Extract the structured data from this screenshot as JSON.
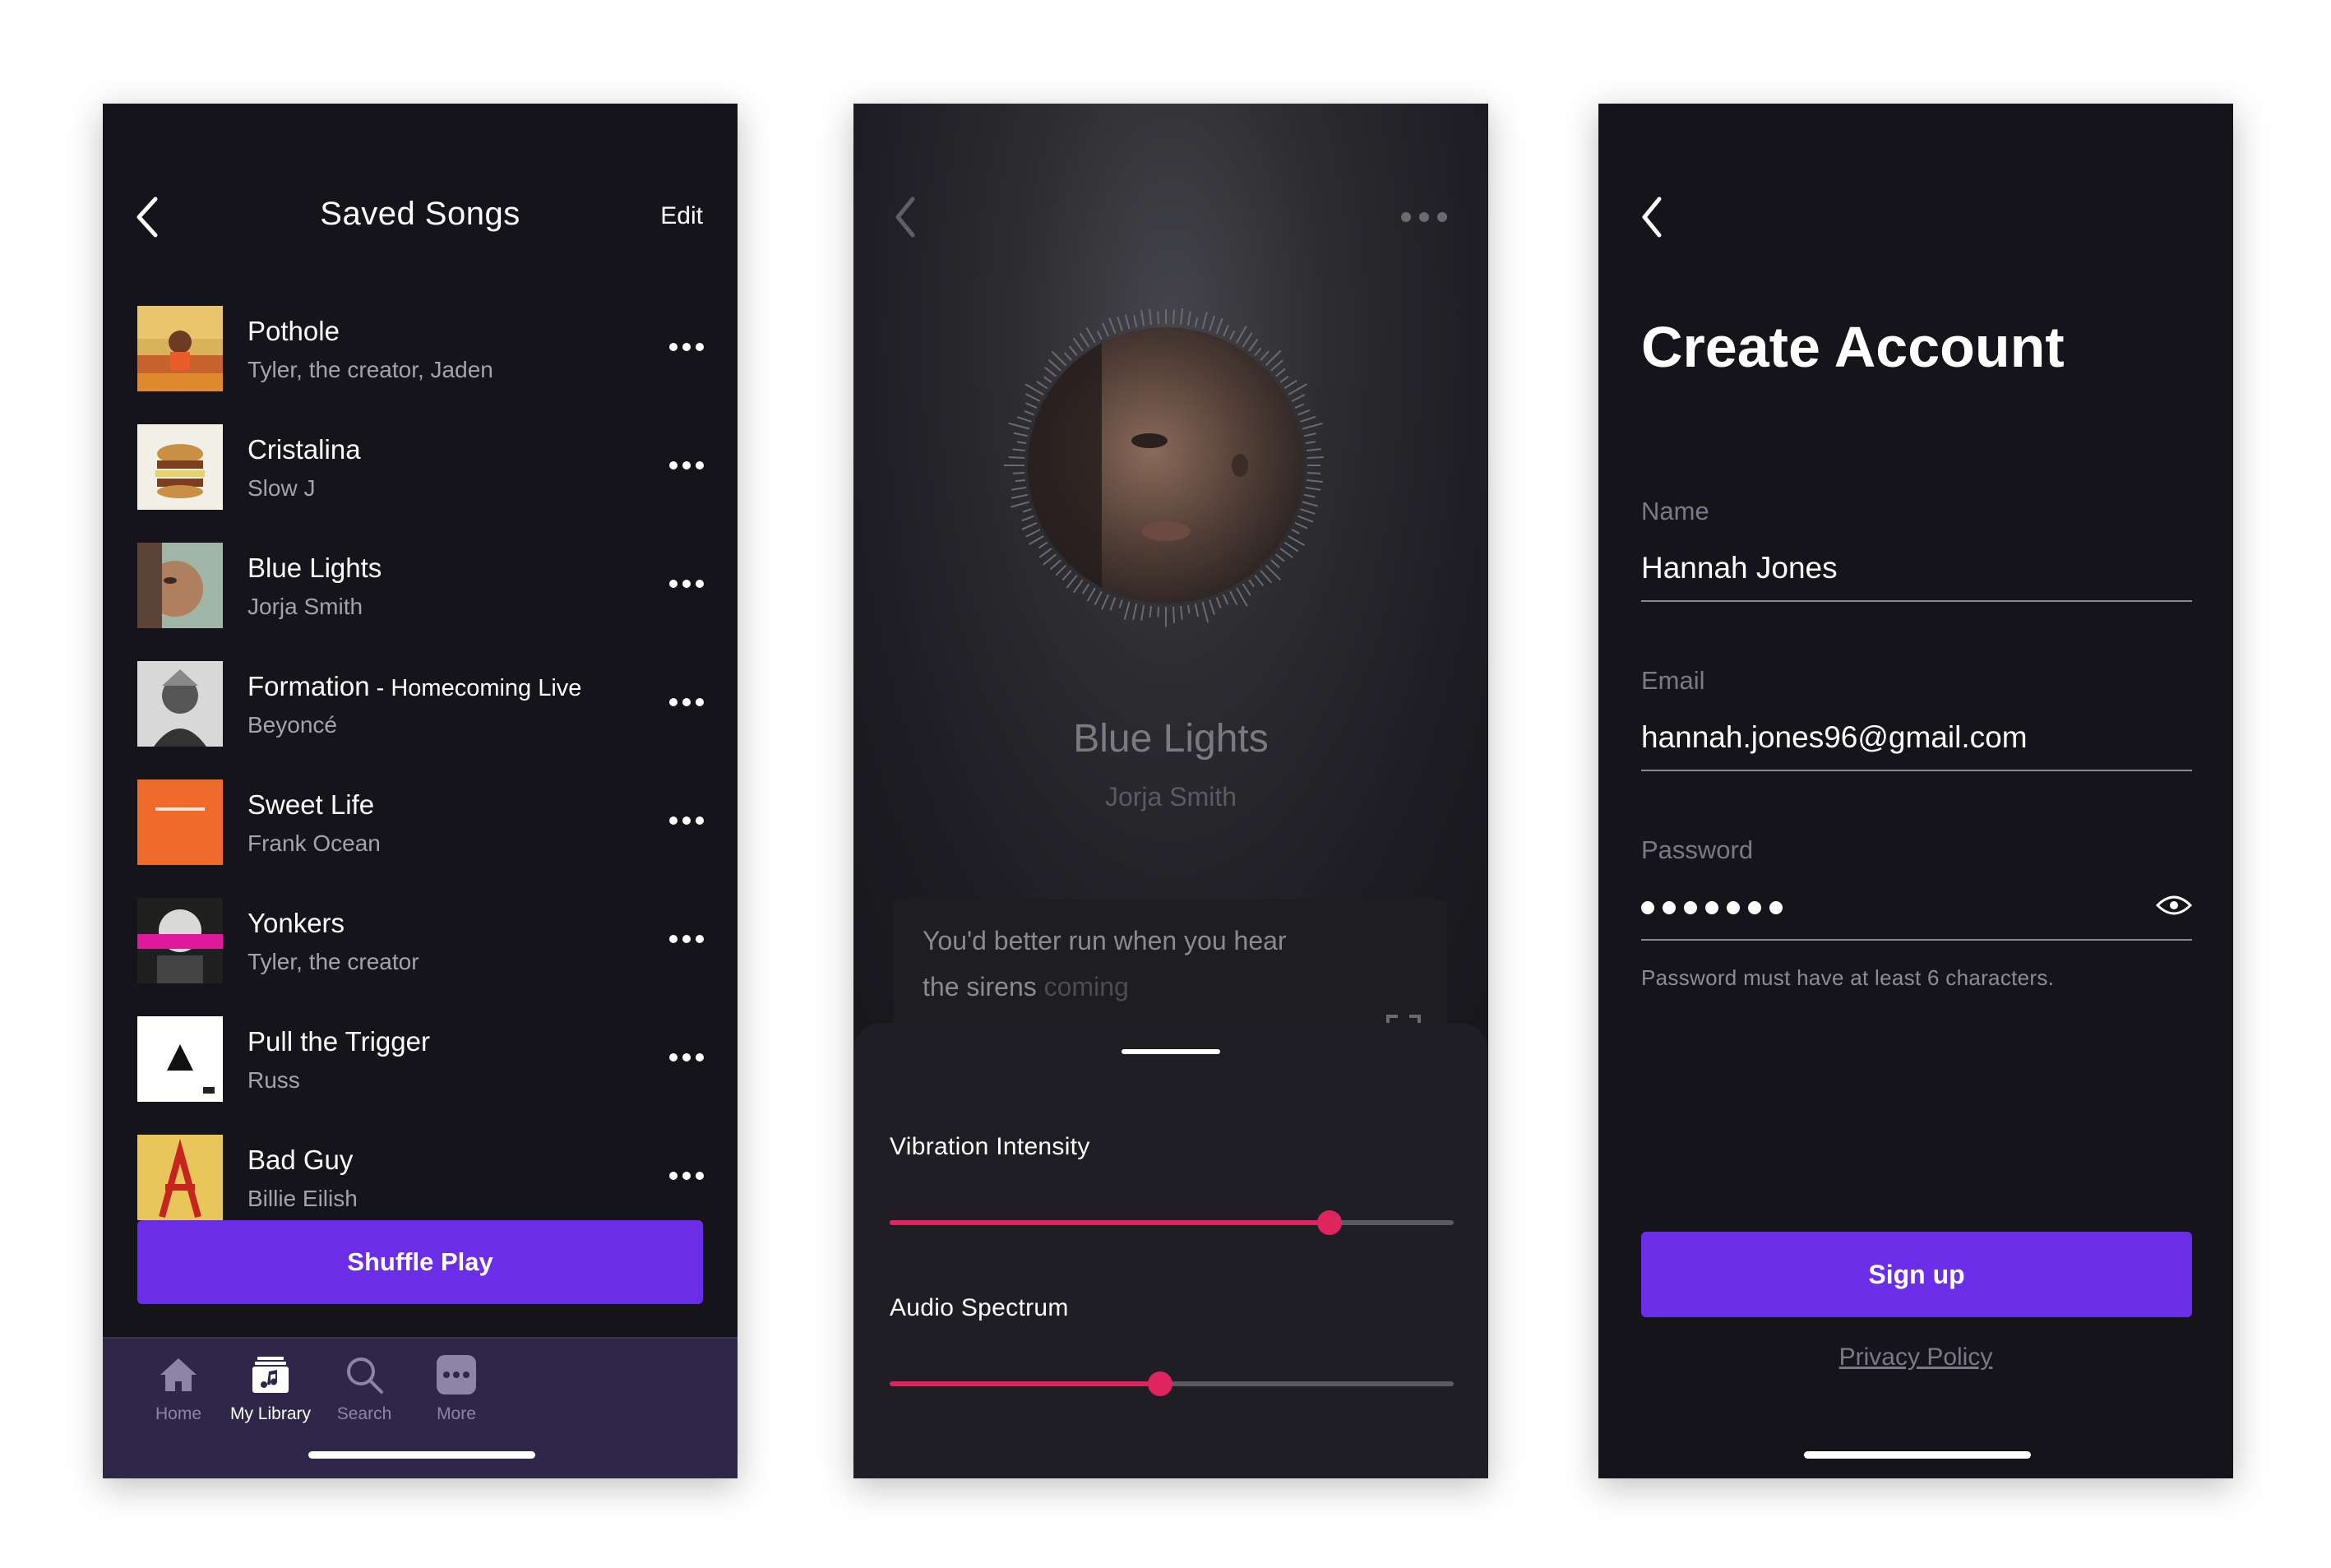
{
  "screen1": {
    "title": "Saved Songs",
    "edit_label": "Edit",
    "songs": [
      {
        "title": "Pothole",
        "subtitle": "",
        "artist": "Tyler, the creator, Jaden"
      },
      {
        "title": "Cristalina",
        "subtitle": "",
        "artist": "Slow J"
      },
      {
        "title": "Blue Lights",
        "subtitle": "",
        "artist": "Jorja Smith"
      },
      {
        "title": "Formation",
        "subtitle": " - Homecoming Live",
        "artist": "Beyoncé"
      },
      {
        "title": "Sweet Life",
        "subtitle": "",
        "artist": "Frank Ocean"
      },
      {
        "title": "Yonkers",
        "subtitle": "",
        "artist": "Tyler, the creator"
      },
      {
        "title": "Pull the Trigger",
        "subtitle": "",
        "artist": "Russ"
      },
      {
        "title": "Bad Guy",
        "subtitle": "",
        "artist": "Billie Eilish"
      }
    ],
    "shuffle_label": "Shuffle Play",
    "tabs": [
      {
        "label": "Home",
        "icon": "home-icon"
      },
      {
        "label": "My Library",
        "icon": "library-icon"
      },
      {
        "label": "Search",
        "icon": "search-icon"
      },
      {
        "label": "More",
        "icon": "more-icon"
      }
    ],
    "active_tab": "My Library",
    "colors": {
      "background": "#16141b",
      "accent": "#6a2de8",
      "tabbar": "#2f2747"
    }
  },
  "screen2": {
    "song_title": "Blue Lights",
    "artist": "Jorja Smith",
    "lyrics_line1": "You'd better run when you hear",
    "lyrics_line2_bright": "the sirens ",
    "lyrics_line2_dim": "coming",
    "sliders": [
      {
        "label": "Vibration Intensity",
        "value": 0.78
      },
      {
        "label": "Audio Spectrum",
        "value": 0.48
      }
    ],
    "colors": {
      "slider": "#e0245e"
    }
  },
  "screen3": {
    "title": "Create Account",
    "name_label": "Name",
    "name_value": "Hannah Jones",
    "email_label": "Email",
    "email_value": "hannah.jones96@gmail.com",
    "password_label": "Password",
    "password_length": 7,
    "password_hint": "Password must have at least 6 characters.",
    "signup_label": "Sign up",
    "privacy_label": "Privacy Policy"
  }
}
